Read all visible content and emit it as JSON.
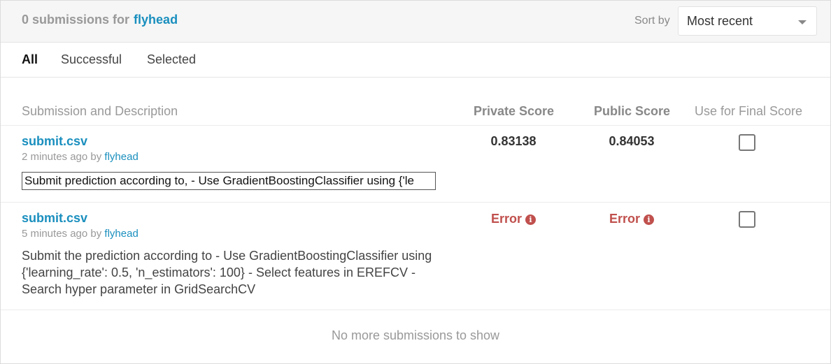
{
  "header": {
    "count_text": "0 submissions for",
    "username": "flyhead",
    "sort_label": "Sort by",
    "sort_value": "Most recent"
  },
  "tabs": [
    {
      "label": "All",
      "active": true
    },
    {
      "label": "Successful",
      "active": false
    },
    {
      "label": "Selected",
      "active": false
    }
  ],
  "columns": {
    "submission": "Submission and Description",
    "private": "Private Score",
    "public": "Public Score",
    "final": "Use for Final Score"
  },
  "submissions": [
    {
      "file": "submit.csv",
      "time": "2 minutes ago",
      "by": "by",
      "user": "flyhead",
      "description": "Submit prediction according to, - Use GradientBoostingClassifier using {'le",
      "private_score": "0.83138",
      "public_score": "0.84053",
      "selected": false
    },
    {
      "file": "submit.csv",
      "time": "5 minutes ago",
      "by": "by",
      "user": "flyhead",
      "description": "Submit the prediction according to - Use GradientBoostingClassifier using {'learning_rate': 0.5, 'n_estimators': 100} - Select features in EREFCV - Search hyper parameter in GridSearchCV",
      "private_score": "Error",
      "public_score": "Error",
      "selected": false
    }
  ],
  "error_icon": "info-circle-icon",
  "footer": "No more submissions to show",
  "colors": {
    "link": "#1a8fbe",
    "error": "#c0504d"
  }
}
